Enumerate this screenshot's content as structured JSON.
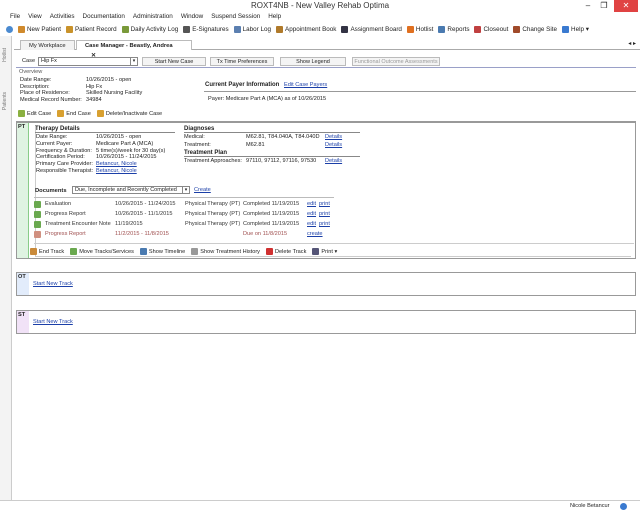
{
  "window": {
    "title": "ROXT4NB -  New Valley Rehab Optima",
    "min": "–",
    "max": "❐",
    "close": "✕"
  },
  "menu": [
    "File",
    "View",
    "Activities",
    "Documentation",
    "Administration",
    "Window",
    "Suspend Session",
    "Help"
  ],
  "toolbar": [
    {
      "label": "New Patient",
      "icon": "new-patient-icon",
      "color": "#d08a2c"
    },
    {
      "label": "Patient Record",
      "icon": "patient-record-icon",
      "color": "#c9922a"
    },
    {
      "label": "Daily Activity Log",
      "icon": "clock-icon",
      "color": "#7a9a3a"
    },
    {
      "label": "E-Signatures",
      "icon": "pen-icon",
      "color": "#555"
    },
    {
      "label": "Labor Log",
      "icon": "person-icon",
      "color": "#5b7fb0"
    },
    {
      "label": "Appointment Book",
      "icon": "book-icon",
      "color": "#b07a2a"
    },
    {
      "label": "Assignment Board",
      "icon": "board-icon",
      "color": "#334"
    },
    {
      "label": "Hotlist",
      "icon": "flame-icon",
      "color": "#e07020"
    },
    {
      "label": "Reports",
      "icon": "report-icon",
      "color": "#4a7ab0"
    },
    {
      "label": "Closeout",
      "icon": "closeout-icon",
      "color": "#c04040"
    },
    {
      "label": "Change Site",
      "icon": "site-icon",
      "color": "#a04a2a"
    },
    {
      "label": "Help ▾",
      "icon": "help-icon",
      "color": "#3a7ad0"
    }
  ],
  "side": {
    "hotlist": "Hotlist",
    "patients": "Patients"
  },
  "tabs": {
    "workplace": "My Workplace",
    "case": "Case Manager - Beastly, Andrea",
    "close": "✕",
    "nav": "◂ ▸"
  },
  "case": {
    "label": "Case",
    "value": "Hip Fx",
    "buttons": [
      "Start New Case",
      "Tx Time Preferences",
      "Show Legend",
      "Functional Outcome Assessments"
    ]
  },
  "overview": {
    "title": "Overview",
    "fields": [
      [
        "Date Range:",
        "10/26/2015 - open"
      ],
      [
        "Description:",
        "Hip Fx"
      ],
      [
        "Place of Residence:",
        "Skilled Nursing Facility"
      ],
      [
        "Medical Record Number:",
        "34984"
      ]
    ]
  },
  "payer": {
    "title": "Current Payer Information",
    "edit": "Edit Case Payers",
    "text": "Payer: Medicare Part A (MCA) as of 10/26/2015"
  },
  "case_actions": [
    "Edit Case",
    "End Case",
    "Delete/Inactivate Case"
  ],
  "pt": {
    "code": "PT",
    "therapy_title": "Therapy Details",
    "therapy": [
      [
        "Date Range:",
        "10/26/2015 - open"
      ],
      [
        "Current Payer:",
        "Medicare Part A (MCA)"
      ],
      [
        "Frequency & Duration:",
        "5 time(s)/week for 30 day(s)"
      ],
      [
        "Certification Period:",
        "10/26/2015 - 11/24/2015"
      ]
    ],
    "links": [
      [
        "Primary Care Provider:",
        "Betancur, Nicole"
      ],
      [
        "Responsible Therapist:",
        "Betancur, Nicole"
      ]
    ],
    "diag_title": "Diagnoses",
    "diag": [
      [
        "Medical:",
        "M62.81, T84.040A, T84.040D",
        "Details"
      ],
      [
        "Treatment:",
        "M62.81",
        "Details"
      ]
    ],
    "plan_title": "Treatment Plan",
    "plan": [
      [
        "Treatment Approaches:",
        "97110, 97112, 97116, 97530",
        "Details"
      ]
    ],
    "docs_label": "Documents",
    "docs_filter": "Due, Incomplete and Recently Completed",
    "create": "Create",
    "docs": [
      {
        "name": "Evaluation",
        "dates": "10/26/2015 - 11/24/2015",
        "discipline": "Physical Therapy (PT)",
        "status": "Completed 11/19/2015",
        "a1": "edit",
        "a2": "print",
        "due": false
      },
      {
        "name": "Progress Report",
        "dates": "10/26/2015 - 11/1/2015",
        "discipline": "Physical Therapy (PT)",
        "status": "Completed 11/19/2015",
        "a1": "edit",
        "a2": "print",
        "due": false
      },
      {
        "name": "Treatment Encounter Note",
        "dates": "11/19/2015",
        "discipline": "Physical Therapy (PT)",
        "status": "Completed 11/19/2015",
        "a1": "edit",
        "a2": "print",
        "due": false
      },
      {
        "name": "Progress Report",
        "dates": "11/2/2015 - 11/8/2015",
        "discipline": "",
        "status": "Due on 11/8/2015",
        "a1": "create",
        "a2": "",
        "due": true
      }
    ],
    "actions": [
      "End Track",
      "Move Tracks/Services",
      "Show Timeline",
      "Show Treatment History",
      "Delete Track",
      "Print ▾"
    ]
  },
  "ot": {
    "code": "OT",
    "link": "Start New Track"
  },
  "st": {
    "code": "ST",
    "link": "Start New Track"
  },
  "status": {
    "user": "Nicole Betancur"
  }
}
